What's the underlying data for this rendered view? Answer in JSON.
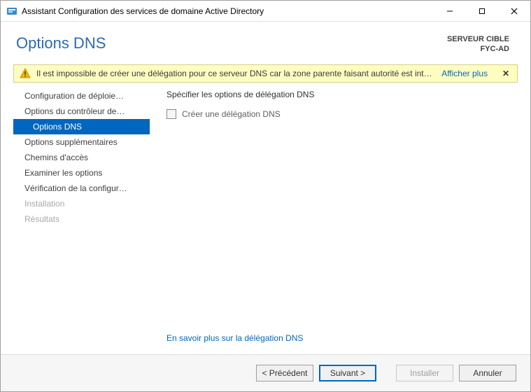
{
  "window": {
    "title": "Assistant Configuration des services de domaine Active Directory"
  },
  "header": {
    "page_title": "Options DNS",
    "server_label": "SERVEUR CIBLE",
    "server_name": "FYC-AD"
  },
  "banner": {
    "text": "Il est impossible de créer une délégation pour ce serveur DNS car la zone parente faisant autorité est intro…",
    "more_label": "Afficher plus"
  },
  "sidebar": {
    "items": [
      {
        "label": "Configuration de déploie…",
        "active": false,
        "disabled": false
      },
      {
        "label": "Options du contrôleur de…",
        "active": false,
        "disabled": false
      },
      {
        "label": "Options DNS",
        "active": true,
        "disabled": false
      },
      {
        "label": "Options supplémentaires",
        "active": false,
        "disabled": false
      },
      {
        "label": "Chemins d'accès",
        "active": false,
        "disabled": false
      },
      {
        "label": "Examiner les options",
        "active": false,
        "disabled": false
      },
      {
        "label": "Vérification de la configur…",
        "active": false,
        "disabled": false
      },
      {
        "label": "Installation",
        "active": false,
        "disabled": true
      },
      {
        "label": "Résultats",
        "active": false,
        "disabled": true
      }
    ]
  },
  "main": {
    "section_label": "Spécifier les options de délégation DNS",
    "checkbox_label": "Créer une délégation DNS",
    "learn_more": "En savoir plus sur la délégation DNS"
  },
  "footer": {
    "previous": "< Précédent",
    "next": "Suivant >",
    "install": "Installer",
    "cancel": "Annuler"
  }
}
